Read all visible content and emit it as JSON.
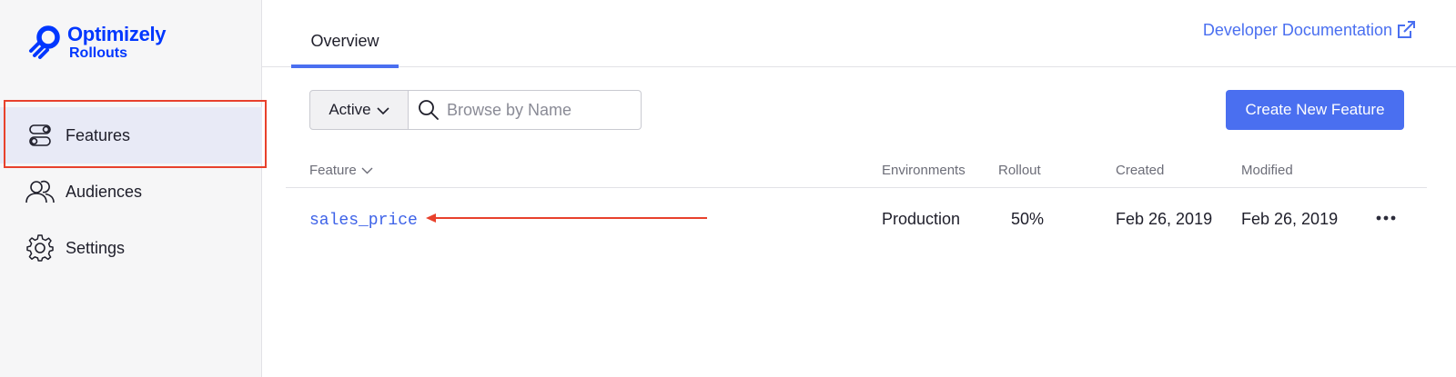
{
  "app": {
    "logo_title": "Optimizely",
    "logo_subtitle": "Rollouts",
    "brand_color": "#0037ff",
    "accent_color": "#4a6ff0"
  },
  "sidebar": {
    "items": [
      {
        "label": "Features",
        "icon": "toggle-icon",
        "active": true
      },
      {
        "label": "Audiences",
        "icon": "users-icon",
        "active": false
      },
      {
        "label": "Settings",
        "icon": "gear-icon",
        "active": false
      }
    ]
  },
  "header": {
    "tabs": [
      {
        "label": "Overview",
        "active": true
      }
    ],
    "docs_link": "Developer Documentation"
  },
  "toolbar": {
    "status_filter": "Active",
    "search_placeholder": "Browse by Name",
    "create_button": "Create New Feature"
  },
  "table": {
    "columns": {
      "feature": "Feature",
      "environments": "Environments",
      "rollout": "Rollout",
      "created": "Created",
      "modified": "Modified"
    },
    "rows": [
      {
        "feature": "sales_price",
        "environments": "Production",
        "rollout": "50%",
        "created": "Feb 26, 2019",
        "modified": "Feb 26, 2019"
      }
    ]
  },
  "annotations": {
    "highlight_color": "#e8412c"
  }
}
